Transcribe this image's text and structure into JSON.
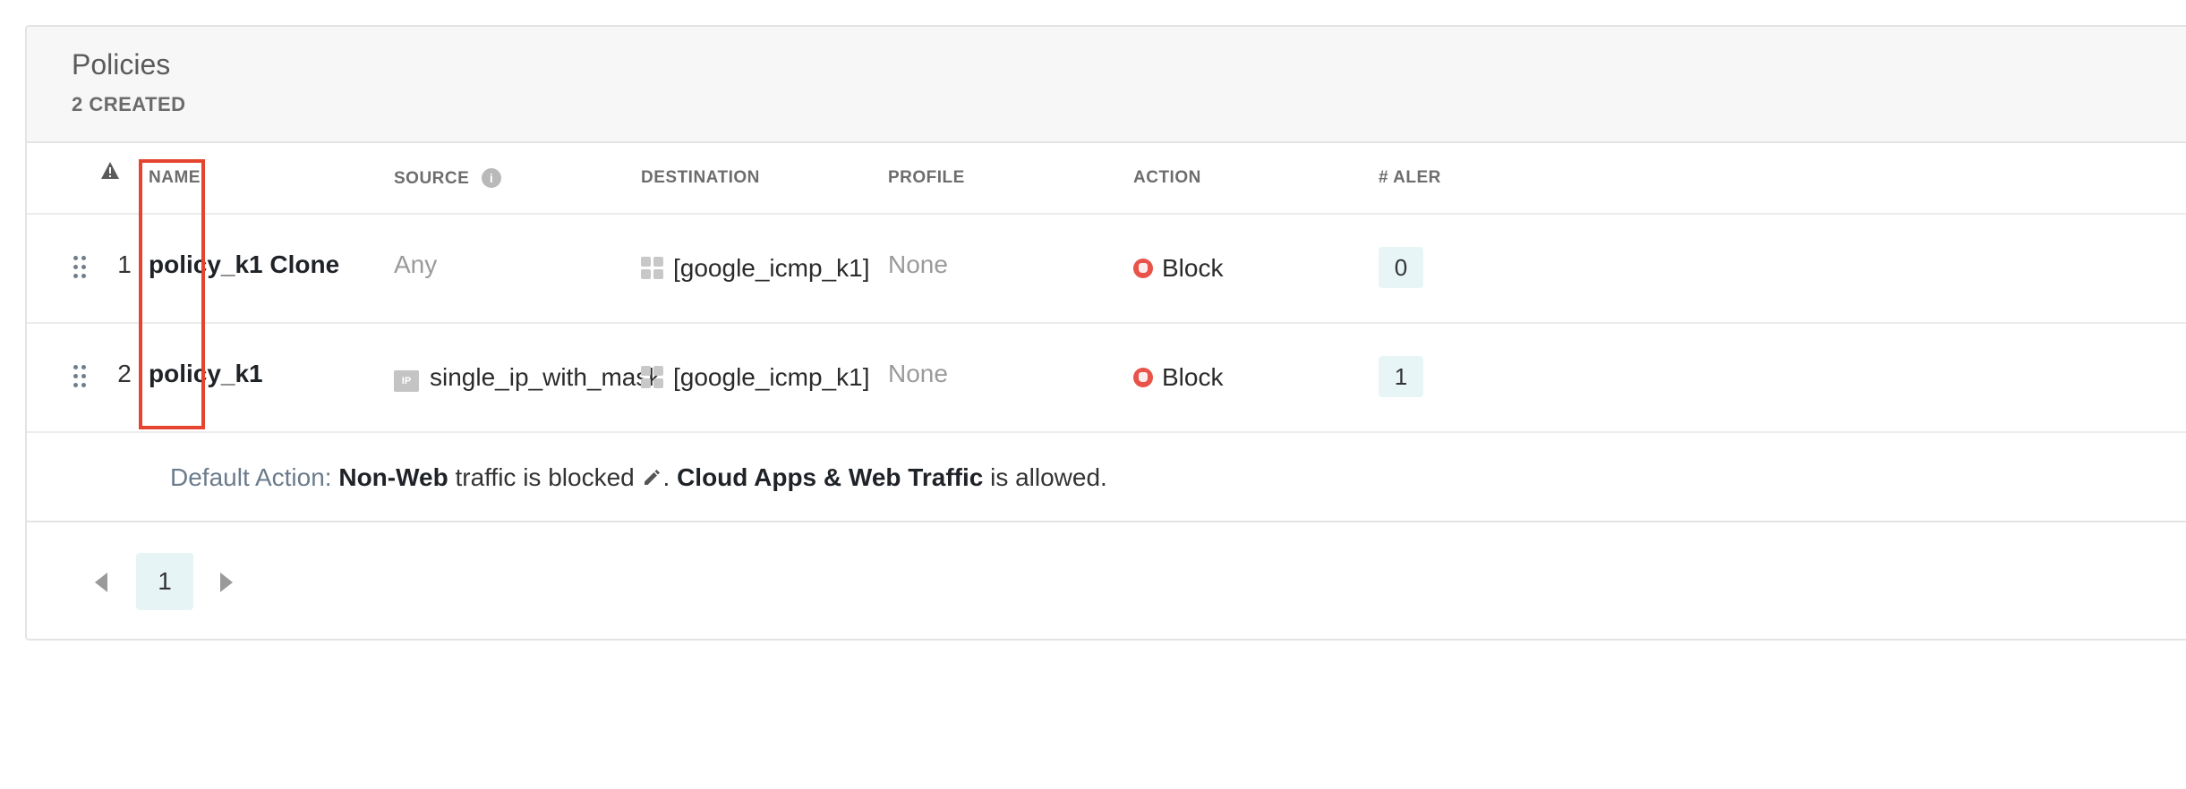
{
  "panel": {
    "title": "Policies",
    "subtitle": "2 CREATED"
  },
  "columns": {
    "name": "NAME",
    "source": "SOURCE",
    "destination": "DESTINATION",
    "profile": "PROFILE",
    "action": "ACTION",
    "alerts": "# ALER"
  },
  "icons": {
    "header_warning": "warning-triangle-icon",
    "source_info": "info-icon",
    "row_drag": "drag-handle-icon",
    "destination": "app-group-icon",
    "source_ip": "ip-icon",
    "action_block": "block-hand-icon",
    "edit": "pencil-icon"
  },
  "rows": [
    {
      "index": "1",
      "name": "policy_k1 Clone",
      "source": "Any",
      "destination": "[google_icmp_k1]",
      "profile": "None",
      "action": "Block",
      "alerts": "0"
    },
    {
      "index": "2",
      "name": "policy_k1",
      "source": "single_ip_with_mask",
      "destination": "[google_icmp_k1]",
      "profile": "None",
      "action": "Block",
      "alerts": "1"
    }
  ],
  "default_action": {
    "label": "Default Action:",
    "part1_bold": "Non-Web",
    "part1_text": " traffic is blocked",
    "sep": ".",
    "part2_bold": "Cloud Apps & Web Traffic",
    "part2_text": " is allowed."
  },
  "pagination": {
    "current_page": "1"
  },
  "colors": {
    "block": "#e8534a",
    "highlight": "#e5442f",
    "badge_bg": "#e8f5f7"
  }
}
